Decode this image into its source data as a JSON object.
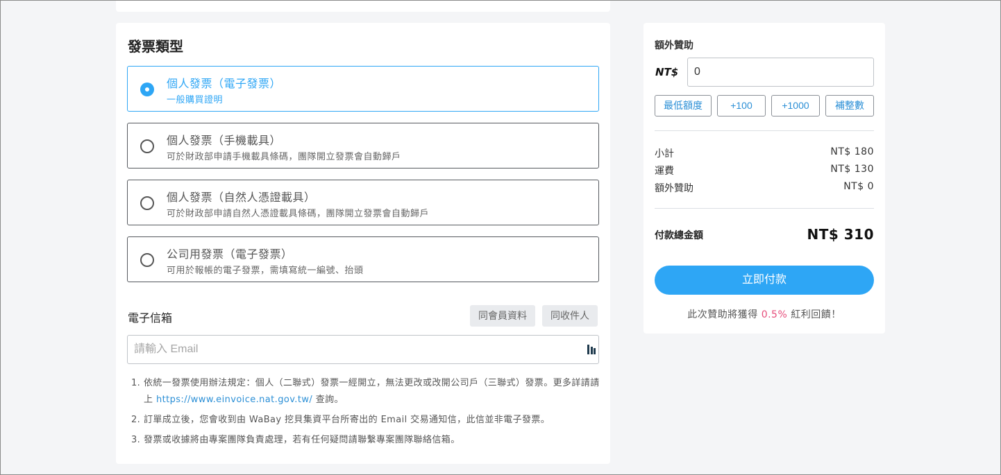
{
  "invoice": {
    "title": "發票類型",
    "options": [
      {
        "title": "個人發票（電子發票）",
        "desc": "一般購買證明",
        "selected": true
      },
      {
        "title": "個人發票（手機載具）",
        "desc": "可於財政部申請手機載具條碼，團隊開立發票會自動歸戶",
        "selected": false
      },
      {
        "title": "個人發票（自然人憑證載具）",
        "desc": "可於財政部申請自然人憑證載具條碼，團隊開立發票會自動歸戶",
        "selected": false
      },
      {
        "title": "公司用發票（電子發票）",
        "desc": "可用於報帳的電子發票，需填寫統一編號、抬頭",
        "selected": false
      }
    ]
  },
  "email": {
    "label": "電子信箱",
    "same_member_label": "同會員資料",
    "same_recipient_label": "同收件人",
    "placeholder": "請輸入 Email",
    "value": ""
  },
  "notes": {
    "n1": "1.",
    "item1_text": "依統一發票使用辦法規定：個人（二聯式）發票一經開立，無法更改或改開公司戶（三聯式）發票。更多詳請請上",
    "item1_link": "https://www.einvoice.nat.gov.tw/",
    "item1_suffix": "查詢。",
    "n2": "2.",
    "item2": "訂單成立後，您會收到由 WaBay 挖貝集資平台所寄出的 Email 交易通知信，此信並非電子發票。",
    "n3": "3.",
    "item3": "發票或收據將由專案團隊負責處理，若有任何疑問請聯繫專案團隊聯絡信箱。"
  },
  "summary": {
    "extra_label": "額外贊助",
    "currency": "NT$",
    "extra_value": "0",
    "quick_buttons": [
      "最低額度",
      "+100",
      "+1000",
      "補整數"
    ],
    "subtotal_label": "小計",
    "subtotal_value": "NT$ 180",
    "shipping_label": "運費",
    "shipping_value": "NT$ 130",
    "extra_row_label": "額外贊助",
    "extra_row_value": "NT$ 0",
    "total_label": "付款總金額",
    "total_value": "NT$ 310",
    "pay_label": "立即付款",
    "bonus_prefix": "此次贊助將獲得",
    "bonus_pct": "0.5%",
    "bonus_suffix": "紅利回饋！"
  },
  "colors": {
    "accent": "#2ea6f5",
    "highlight": "#e64c7a",
    "link": "#2b8fd6"
  },
  "icons": {
    "autofill": "autofill-icon",
    "radio": "radio-icon"
  }
}
